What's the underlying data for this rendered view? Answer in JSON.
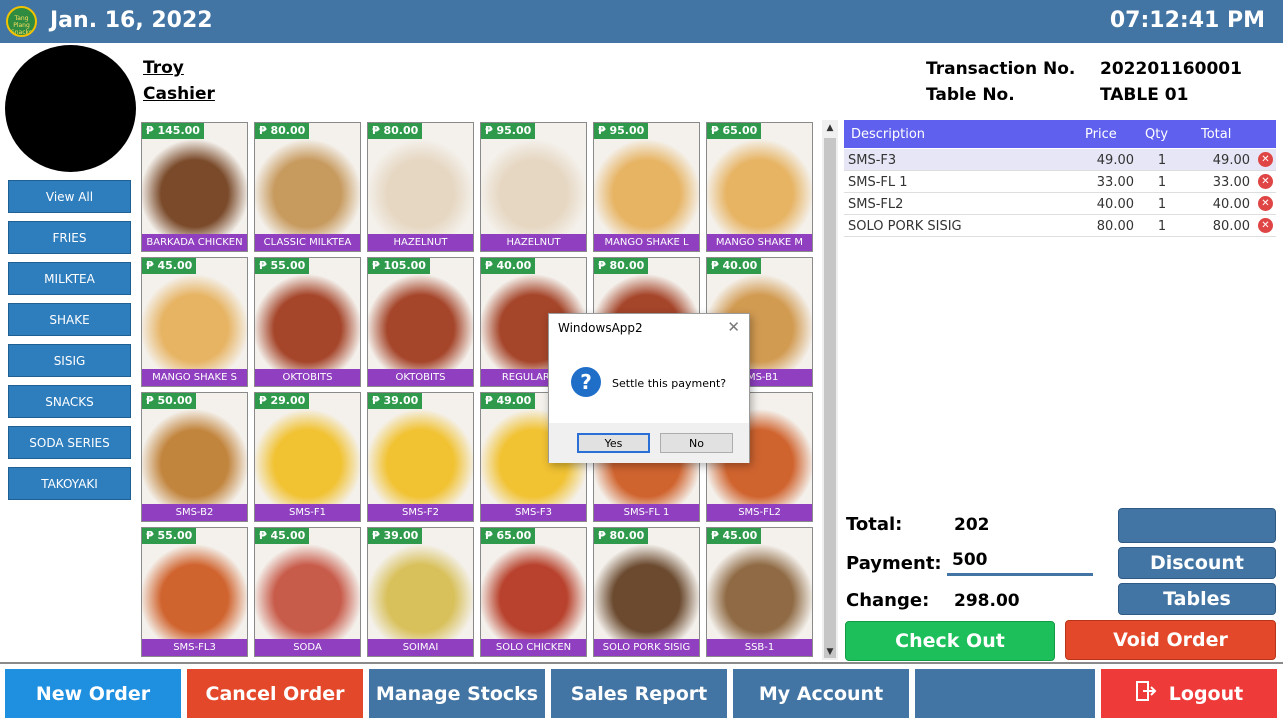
{
  "header": {
    "logo_text": "Tang Plang Snacks",
    "date": "Jan. 16, 2022",
    "time": "07:12:41 PM"
  },
  "user": {
    "name": "Troy",
    "role": "Cashier"
  },
  "transaction": {
    "no_label": "Transaction No.",
    "no_value": "202201160001",
    "table_label": "Table No.",
    "table_value": "TABLE 01"
  },
  "categories": [
    "View All",
    "FRIES",
    "MILKTEA",
    "SHAKE",
    "SISIG",
    "SNACKS",
    "SODA SERIES",
    "TAKOYAKI"
  ],
  "products": [
    {
      "name": "BARKADA CHICKEN",
      "price": "₱ 145.00",
      "color": "#7a4a2a"
    },
    {
      "name": "CLASSIC MILKTEA",
      "price": "₱ 80.00",
      "color": "#c79a5e"
    },
    {
      "name": "HAZELNUT",
      "price": "₱ 80.00",
      "color": "#e6d7c2"
    },
    {
      "name": "HAZELNUT",
      "price": "₱ 95.00",
      "color": "#e6d7c2"
    },
    {
      "name": "MANGO SHAKE L",
      "price": "₱ 95.00",
      "color": "#e7b464"
    },
    {
      "name": "MANGO SHAKE M",
      "price": "₱ 65.00",
      "color": "#e7b464"
    },
    {
      "name": "MANGO SHAKE S",
      "price": "₱ 45.00",
      "color": "#e7b464"
    },
    {
      "name": "OKTOBITS",
      "price": "₱ 55.00",
      "color": "#a5452a"
    },
    {
      "name": "OKTOBITS",
      "price": "₱ 105.00",
      "color": "#a5452a"
    },
    {
      "name": "REGULAR TA",
      "price": "₱ 40.00",
      "color": "#a5452a"
    },
    {
      "name": "",
      "price": "₱ 80.00",
      "color": "#a5452a"
    },
    {
      "name": "SMS-B1",
      "price": "₱ 40.00",
      "color": "#d29b52"
    },
    {
      "name": "SMS-B2",
      "price": "₱ 50.00",
      "color": "#c2853e"
    },
    {
      "name": "SMS-F1",
      "price": "₱ 29.00",
      "color": "#f1c232"
    },
    {
      "name": "SMS-F2",
      "price": "₱ 39.00",
      "color": "#f1c232"
    },
    {
      "name": "SMS-F3",
      "price": "₱ 49.00",
      "color": "#f1c232"
    },
    {
      "name": "SMS-FL 1",
      "price": "",
      "color": "#d0642f"
    },
    {
      "name": "SMS-FL2",
      "price": "",
      "color": "#d0642f"
    },
    {
      "name": "SMS-FL3",
      "price": "₱ 55.00",
      "color": "#d0642f"
    },
    {
      "name": "SODA",
      "price": "₱ 45.00",
      "color": "#c85c4b"
    },
    {
      "name": "SOIMAI",
      "price": "₱ 39.00",
      "color": "#d8c05a"
    },
    {
      "name": "SOLO CHICKEN",
      "price": "₱ 65.00",
      "color": "#b8422d"
    },
    {
      "name": "SOLO PORK SISIG",
      "price": "₱ 80.00",
      "color": "#6b4a2f"
    },
    {
      "name": "SSB-1",
      "price": "₱ 45.00",
      "color": "#8f6a44"
    }
  ],
  "order_table": {
    "headers": {
      "desc": "Description",
      "price": "Price",
      "qty": "Qty",
      "total": "Total"
    },
    "rows": [
      {
        "desc": "SMS-F3",
        "price": "49.00",
        "qty": "1",
        "total": "49.00"
      },
      {
        "desc": "SMS-FL 1",
        "price": "33.00",
        "qty": "1",
        "total": "33.00"
      },
      {
        "desc": "SMS-FL2",
        "price": "40.00",
        "qty": "1",
        "total": "40.00"
      },
      {
        "desc": "SOLO PORK SISIG",
        "price": "80.00",
        "qty": "1",
        "total": "80.00"
      }
    ]
  },
  "summary": {
    "total_label": "Total:",
    "total_value": "202",
    "payment_label": "Payment:",
    "payment_value": "500",
    "change_label": "Change:",
    "change_value": "298.00"
  },
  "side_buttons": {
    "blank": "",
    "discount": "Discount",
    "tables": "Tables",
    "checkout": "Check Out",
    "void": "Void Order"
  },
  "bottom_buttons": {
    "new_order": "New Order",
    "cancel_order": "Cancel Order",
    "manage_stocks": "Manage Stocks",
    "sales_report": "Sales Report",
    "my_account": "My Account",
    "blank": "",
    "logout": "Logout"
  },
  "dialog": {
    "title": "WindowsApp2",
    "message": "Settle this payment?",
    "yes": "Yes",
    "no": "No"
  },
  "colors": {
    "header": "#4375a4",
    "category": "#2e7dbd",
    "price_tag": "#2f9a4c",
    "name_tag": "#8f3fbf",
    "order_header": "#6060ee",
    "checkout": "#1dbf5a",
    "void": "#e4482a",
    "new_order": "#1f8fe0",
    "cancel_order": "#e4482a",
    "logout": "#ef3a3a"
  }
}
